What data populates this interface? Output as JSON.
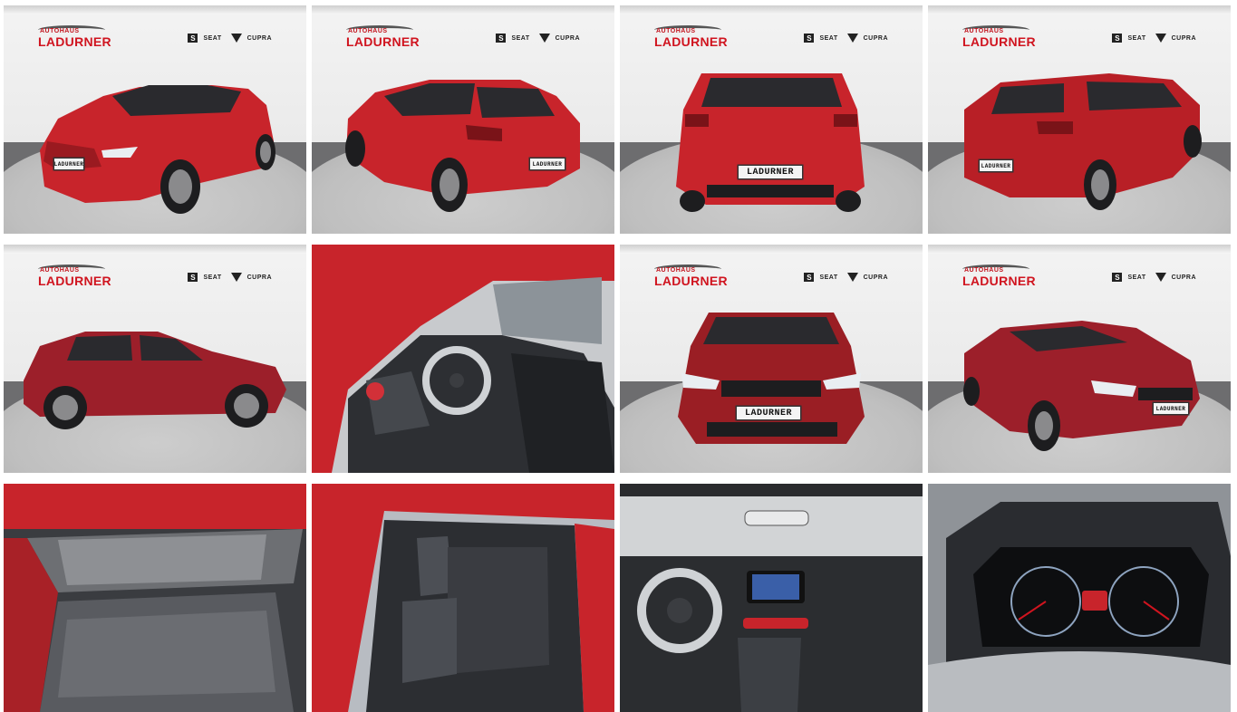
{
  "gallery": {
    "dealer": {
      "small": "AUTOHAUS",
      "big": "LADURNER"
    },
    "brands": {
      "seat_mark": "S",
      "seat": "SEAT",
      "cupra": "CUPRA"
    },
    "plate_text": "LADURNER",
    "photos": [
      {
        "view": "front-left"
      },
      {
        "view": "rear-left"
      },
      {
        "view": "rear"
      },
      {
        "view": "rear-right"
      },
      {
        "view": "side"
      },
      {
        "view": "interior-driver-door"
      },
      {
        "view": "front"
      },
      {
        "view": "front-right"
      },
      {
        "view": "trunk"
      },
      {
        "view": "rear-seats"
      },
      {
        "view": "dashboard"
      },
      {
        "view": "instrument-cluster"
      }
    ]
  },
  "colors": {
    "car_red": "#c8242b",
    "logo_red": "#d0141f",
    "floor": "#6d6d6f"
  }
}
